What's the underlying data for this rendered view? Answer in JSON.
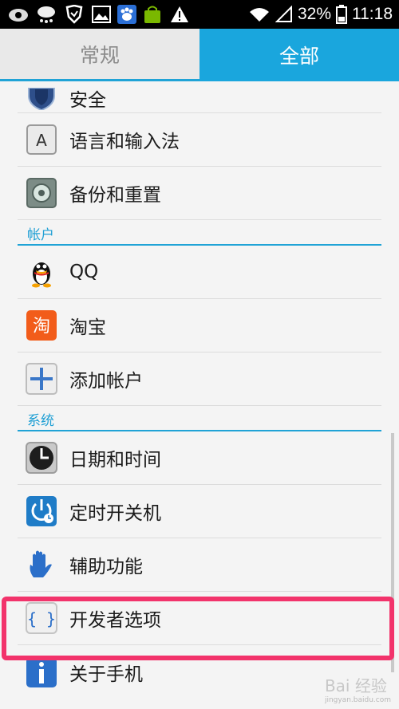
{
  "status_bar": {
    "battery_percent": "32%",
    "time": "11:18"
  },
  "tabs": [
    {
      "label": "常规"
    },
    {
      "label": "全部"
    }
  ],
  "rows_top": [
    {
      "label": "安全",
      "icon": "shield-icon"
    },
    {
      "label": "语言和输入法",
      "icon": "language-icon"
    },
    {
      "label": "备份和重置",
      "icon": "backup-icon"
    }
  ],
  "sections": {
    "accounts": "帐户",
    "system": "系统"
  },
  "accounts": [
    {
      "label": "QQ",
      "icon": "qq-icon"
    },
    {
      "label": "淘宝",
      "icon": "taobao-icon",
      "icon_glyph": "淘"
    },
    {
      "label": "添加帐户",
      "icon": "add-icon"
    }
  ],
  "system": [
    {
      "label": "日期和时间",
      "icon": "clock-icon"
    },
    {
      "label": "定时开关机",
      "icon": "power-timer-icon"
    },
    {
      "label": "辅助功能",
      "icon": "hand-icon"
    },
    {
      "label": "开发者选项",
      "icon": "braces-icon"
    },
    {
      "label": "关于手机",
      "icon": "info-icon"
    }
  ],
  "watermark": {
    "text": "Bai 经验",
    "sub": "jingyan.baidu.com"
  },
  "colors": {
    "accent": "#1aa6dd",
    "highlight": "#f2336b"
  }
}
